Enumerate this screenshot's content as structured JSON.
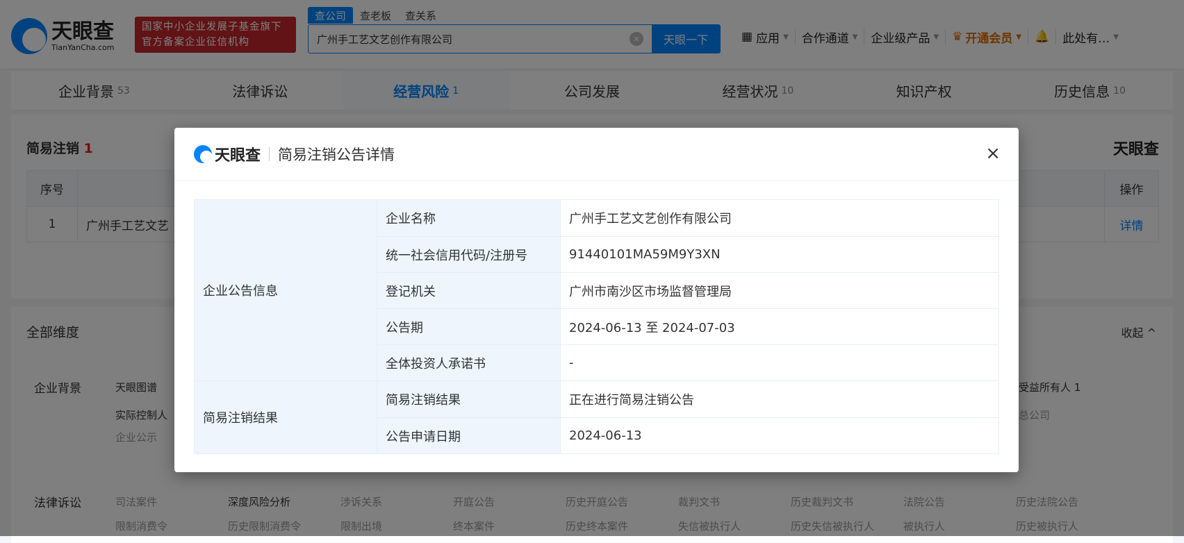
{
  "header": {
    "logo_cn": "天眼查",
    "logo_en": "TianYanCha.com",
    "badge_line1": "国家中小企业发展子基金旗下",
    "badge_line2": "官方备案企业征信机构",
    "search_tabs": [
      "查公司",
      "查老板",
      "查关系"
    ],
    "search_value": "广州手工艺文艺创作有限公司",
    "search_button": "天眼一下",
    "nav": [
      "应用",
      "合作通道",
      "企业级产品",
      "开通会员",
      "此处有…"
    ]
  },
  "tabs": [
    {
      "label": "企业背景",
      "count": "53"
    },
    {
      "label": "法律诉讼",
      "count": ""
    },
    {
      "label": "经营风险",
      "count": "1"
    },
    {
      "label": "公司发展",
      "count": ""
    },
    {
      "label": "经营状况",
      "count": "10"
    },
    {
      "label": "知识产权",
      "count": ""
    },
    {
      "label": "历史信息",
      "count": "10"
    }
  ],
  "section": {
    "title": "简易注销",
    "count": "1",
    "brand": "天眼查",
    "headers": [
      "序号",
      "操作"
    ],
    "row": {
      "index": "1",
      "name": "广州手工艺文艺",
      "action": "详情"
    }
  },
  "dimensions": {
    "title": "全部维度",
    "collapse": "收起 ^",
    "bg_label": "企业背景",
    "bg_items": [
      "天眼图谱",
      "实际控制人",
      "企业公示",
      "受益所有人 1",
      "总公司"
    ],
    "law_label": "法律诉讼",
    "law_row1": [
      "司法案件",
      "深度风险分析",
      "涉诉关系",
      "开庭公告",
      "历史开庭公告",
      "裁判文书",
      "历史裁判文书",
      "法院公告",
      "历史法院公告"
    ],
    "law_row2": [
      "限制消费令",
      "历史限制消费令",
      "限制出境",
      "终本案件",
      "历史终本案件",
      "失信被执行人",
      "历史失信被执行人",
      "被执行人",
      "历史被执行人"
    ]
  },
  "modal": {
    "logo": "天眼查",
    "title": "简易注销公告详情",
    "close": "×",
    "groups": [
      {
        "label": "企业公告信息",
        "rows": [
          [
            "企业名称",
            "广州手工艺文艺创作有限公司"
          ],
          [
            "统一社会信用代码/注册号",
            "91440101MA59M9Y3XN"
          ],
          [
            "登记机关",
            "广州市南沙区市场监督管理局"
          ],
          [
            "公告期",
            "2024-06-13 至 2024-07-03"
          ],
          [
            "全体投资人承诺书",
            "-"
          ]
        ]
      },
      {
        "label": "简易注销结果",
        "rows": [
          [
            "简易注销结果",
            "正在进行简易注销公告"
          ],
          [
            "公告申请日期",
            "2024-06-13"
          ]
        ]
      }
    ]
  }
}
